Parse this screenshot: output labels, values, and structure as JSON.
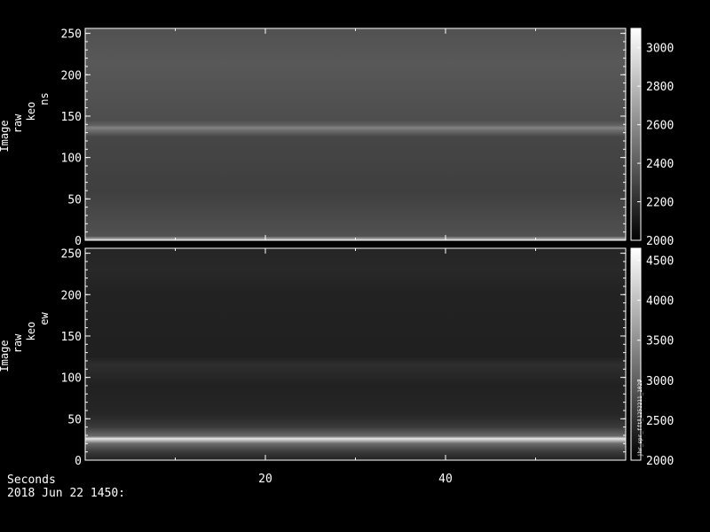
{
  "chart_data": [
    {
      "type": "heatmap",
      "ylabel": [
        "Image",
        "raw",
        "keo",
        "ns"
      ],
      "ylim": [
        0,
        256
      ],
      "yticks": [
        0,
        50,
        100,
        150,
        200,
        250
      ],
      "xlim": [
        0,
        60
      ],
      "xticks": [
        20,
        40
      ],
      "colorbar": {
        "range": [
          2000,
          3100
        ],
        "ticks": [
          2000,
          2200,
          2400,
          2600,
          2800,
          3000
        ]
      },
      "bands": [
        {
          "y": 0,
          "value": 2900
        },
        {
          "y": 5,
          "value": 2350
        },
        {
          "y": 60,
          "value": 2270
        },
        {
          "y": 125,
          "value": 2300
        },
        {
          "y": 133,
          "value": 2480
        },
        {
          "y": 136,
          "value": 2560
        },
        {
          "y": 139,
          "value": 2420
        },
        {
          "y": 145,
          "value": 2330
        },
        {
          "y": 180,
          "value": 2360
        },
        {
          "y": 215,
          "value": 2380
        },
        {
          "y": 256,
          "value": 2350
        }
      ]
    },
    {
      "type": "heatmap",
      "ylabel": [
        "Image",
        "raw",
        "keo",
        "ew"
      ],
      "ylim": [
        0,
        256
      ],
      "yticks": [
        0,
        50,
        100,
        150,
        200,
        250
      ],
      "xlim": [
        0,
        60
      ],
      "xticks": [
        20,
        40
      ],
      "colorbar": {
        "range": [
          2000,
          4650
        ],
        "ticks": [
          2000,
          2500,
          3000,
          3500,
          4000,
          4500
        ]
      },
      "colorbar_annotation": "jhr_spr_fft_1252211_1029",
      "bands": [
        {
          "y": 0,
          "value": 2350
        },
        {
          "y": 10,
          "value": 2600
        },
        {
          "y": 20,
          "value": 3100
        },
        {
          "y": 26,
          "value": 4400
        },
        {
          "y": 29,
          "value": 3100
        },
        {
          "y": 40,
          "value": 2600
        },
        {
          "y": 55,
          "value": 2400
        },
        {
          "y": 90,
          "value": 2340
        },
        {
          "y": 115,
          "value": 2480
        },
        {
          "y": 125,
          "value": 2330
        },
        {
          "y": 200,
          "value": 2350
        },
        {
          "y": 230,
          "value": 2420
        },
        {
          "y": 256,
          "value": 2380
        }
      ]
    }
  ],
  "footer": {
    "x_title": "Seconds",
    "date": "2018 Jun 22 1450:"
  }
}
